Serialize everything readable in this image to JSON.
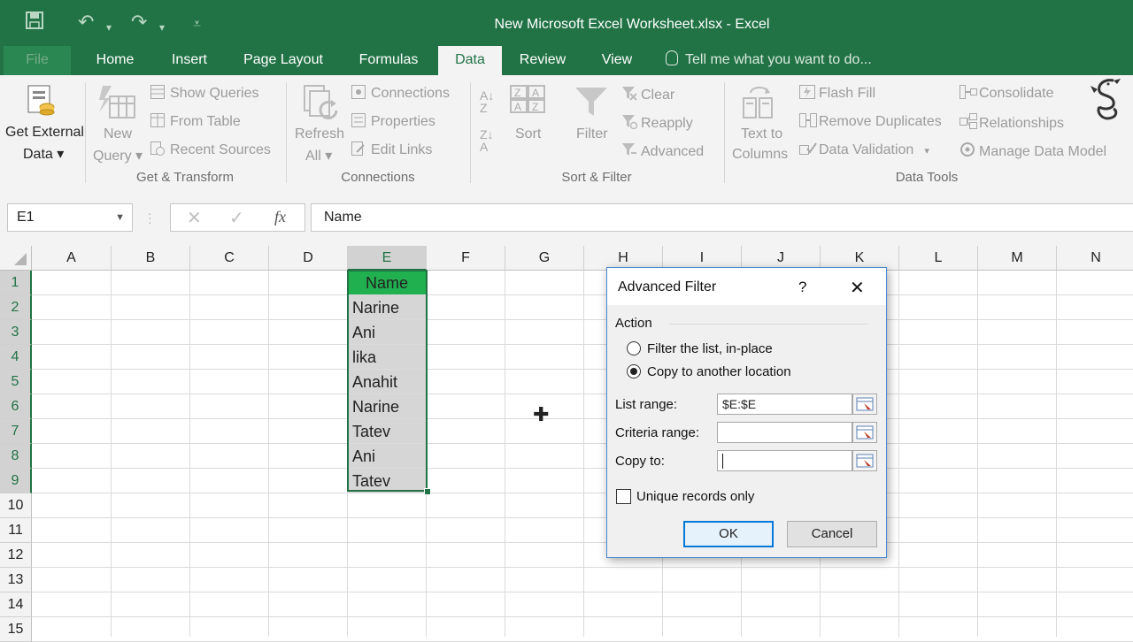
{
  "window": {
    "title": "New Microsoft Excel Worksheet.xlsx - Excel"
  },
  "tabs": [
    {
      "label": "File"
    },
    {
      "label": "Home"
    },
    {
      "label": "Insert"
    },
    {
      "label": "Page Layout"
    },
    {
      "label": "Formulas"
    },
    {
      "label": "Data"
    },
    {
      "label": "Review"
    },
    {
      "label": "View"
    }
  ],
  "active_tab": "Data",
  "tell_me": "Tell me what you want to do...",
  "ribbon": {
    "get_external_1": "Get External",
    "get_external_2": "Data ▾",
    "new_query_1": "New",
    "new_query_2": "Query ▾",
    "show_queries": "Show Queries",
    "from_table": "From Table",
    "recent_sources": "Recent Sources",
    "get_transform": "Get & Transform",
    "refresh_1": "Refresh",
    "refresh_2": "All ▾",
    "connections": "Connections",
    "properties": "Properties",
    "edit_links": "Edit Links",
    "connections_group": "Connections",
    "sort": "Sort",
    "filter": "Filter",
    "clear": "Clear",
    "reapply": "Reapply",
    "advanced": "Advanced",
    "sort_filter_group": "Sort & Filter",
    "text_to_columns_1": "Text to",
    "text_to_columns_2": "Columns",
    "flash_fill": "Flash Fill",
    "remove_duplicates": "Remove Duplicates",
    "data_validation": "Data Validation",
    "consolidate": "Consolidate",
    "relationships": "Relationships",
    "manage_data_model": "Manage Data Model",
    "data_tools_group": "Data Tools"
  },
  "formula_bar": {
    "name_box": "E1",
    "fx": "fx",
    "formula": "Name"
  },
  "columns": [
    "A",
    "B",
    "C",
    "D",
    "E",
    "F",
    "G",
    "H",
    "I",
    "J",
    "K",
    "L",
    "M",
    "N"
  ],
  "rows": [
    "1",
    "2",
    "3",
    "4",
    "5",
    "6",
    "7",
    "8",
    "9",
    "10",
    "11",
    "12",
    "13",
    "14",
    "15"
  ],
  "cells_E": [
    "Name",
    "Narine",
    "Ani",
    "lika",
    "Anahit",
    "Narine",
    "Tatev",
    "Ani",
    "Tatev"
  ],
  "dialog": {
    "title": "Advanced Filter",
    "help": "?",
    "close": "✕",
    "action_label": "Action",
    "option_inplace": "Filter the list, in-place",
    "option_copy": "Copy to another location",
    "list_range_label": "List range:",
    "list_range_value": "$E:$E",
    "criteria_range_label": "Criteria range:",
    "criteria_range_value": "",
    "copy_to_label": "Copy to:",
    "copy_to_value": "",
    "unique_label": "Unique records only",
    "ok": "OK",
    "cancel": "Cancel"
  },
  "colors": {
    "excel_green": "#217346",
    "header_green": "#21b050",
    "selection_gray": "#d6d6d6"
  }
}
